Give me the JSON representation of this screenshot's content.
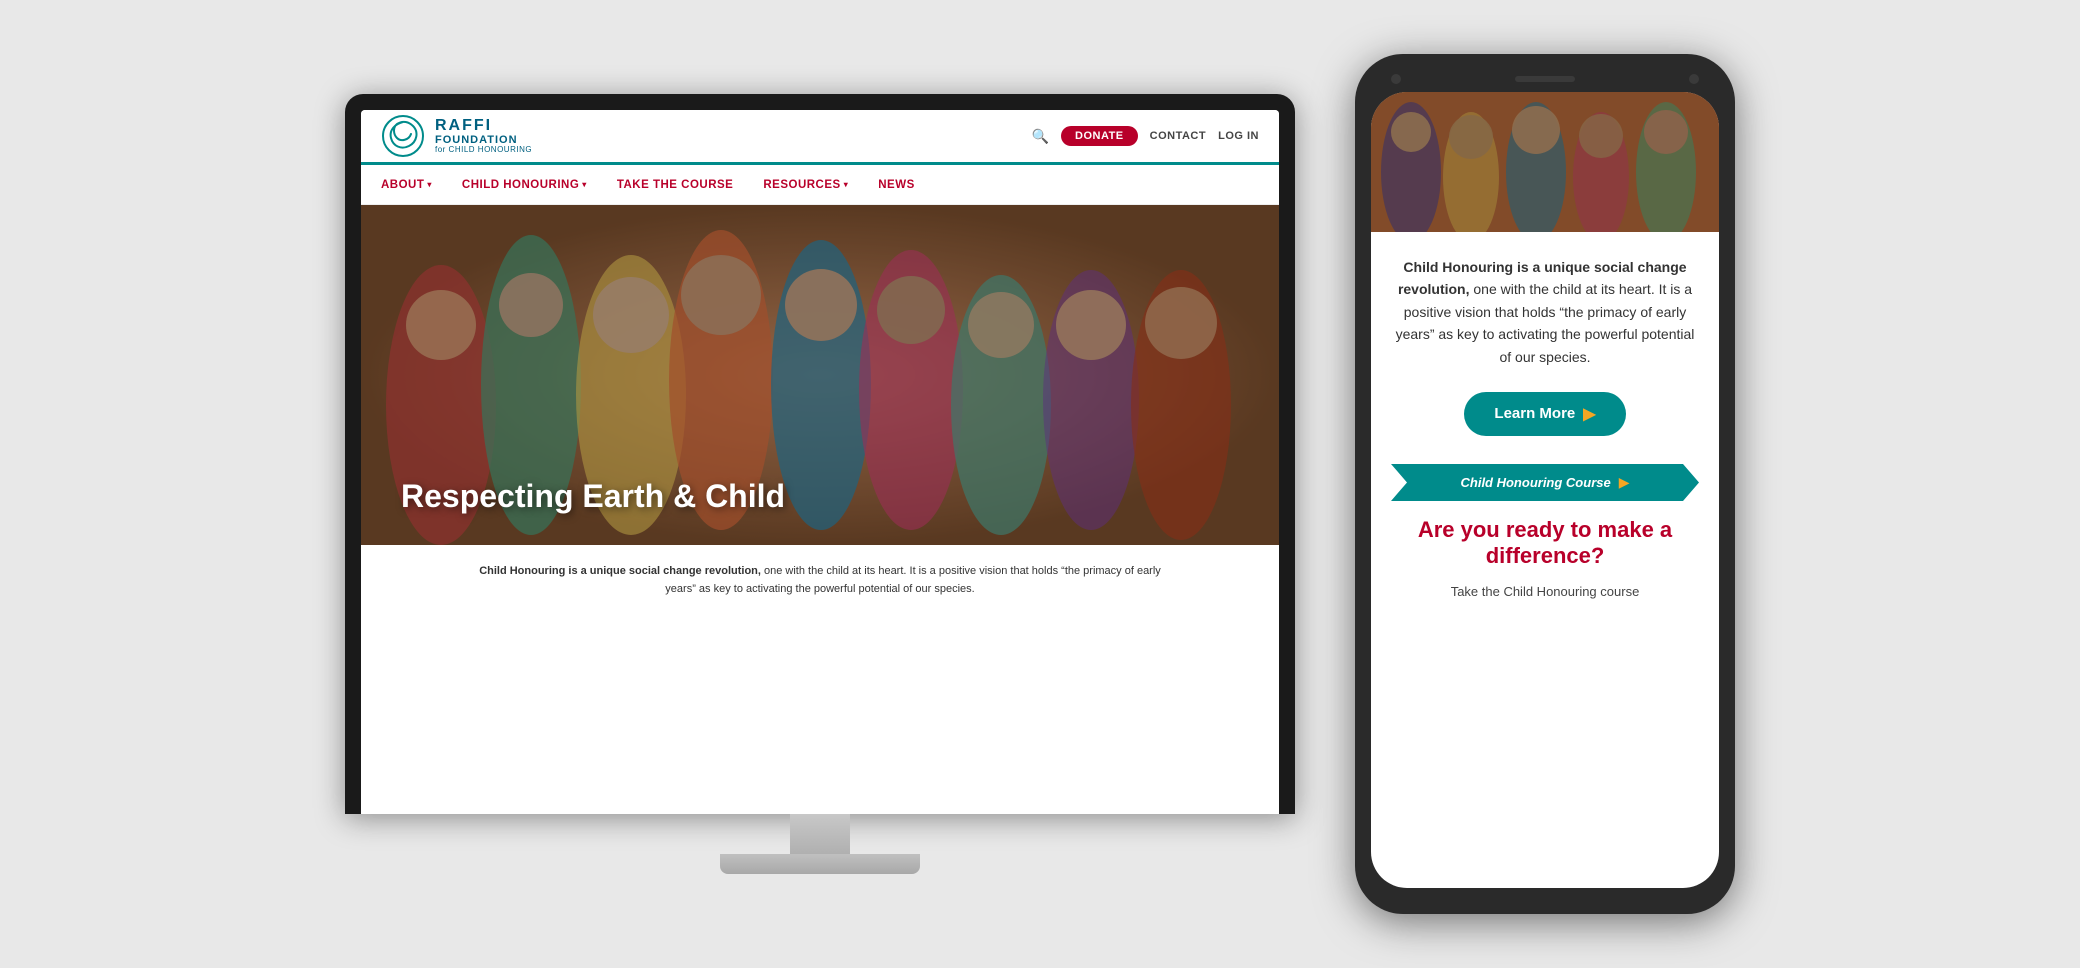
{
  "page": {
    "bg_color": "#e8e8e8"
  },
  "imac": {
    "website": {
      "topbar": {
        "logo": {
          "raffi": "RAFFI",
          "foundation": "FOUNDATION",
          "sub": "for CHILD HONOURING"
        },
        "donate_label": "DONATE",
        "contact_label": "CONTACT",
        "login_label": "LOG IN"
      },
      "navbar": {
        "items": [
          {
            "label": "ABOUT",
            "has_dropdown": true
          },
          {
            "label": "CHILD HONOURING",
            "has_dropdown": true
          },
          {
            "label": "TAKE THE COURSE",
            "has_dropdown": false
          },
          {
            "label": "RESOURCES",
            "has_dropdown": true
          },
          {
            "label": "NEWS",
            "has_dropdown": false
          }
        ]
      },
      "hero": {
        "title": "Respecting Earth & Child",
        "description_strong": "Child Honouring is a unique social change revolution,",
        "description_rest": " one with the child at its heart. It is a positive vision that holds “the primacy of early years” as key to activating the powerful potential of our species."
      }
    }
  },
  "phone": {
    "description_strong": "Child Honouring is a unique social change revolution,",
    "description_rest": " one with the child at its heart. It is a positive vision that holds “the primacy of early years” as key to activating the powerful potential of our species.",
    "learn_more_label": "Learn More",
    "banner_label": "Child Honouring Course",
    "cta_title": "Are you ready to make a difference?",
    "cta_subtitle": "Take the Child Honouring course"
  }
}
